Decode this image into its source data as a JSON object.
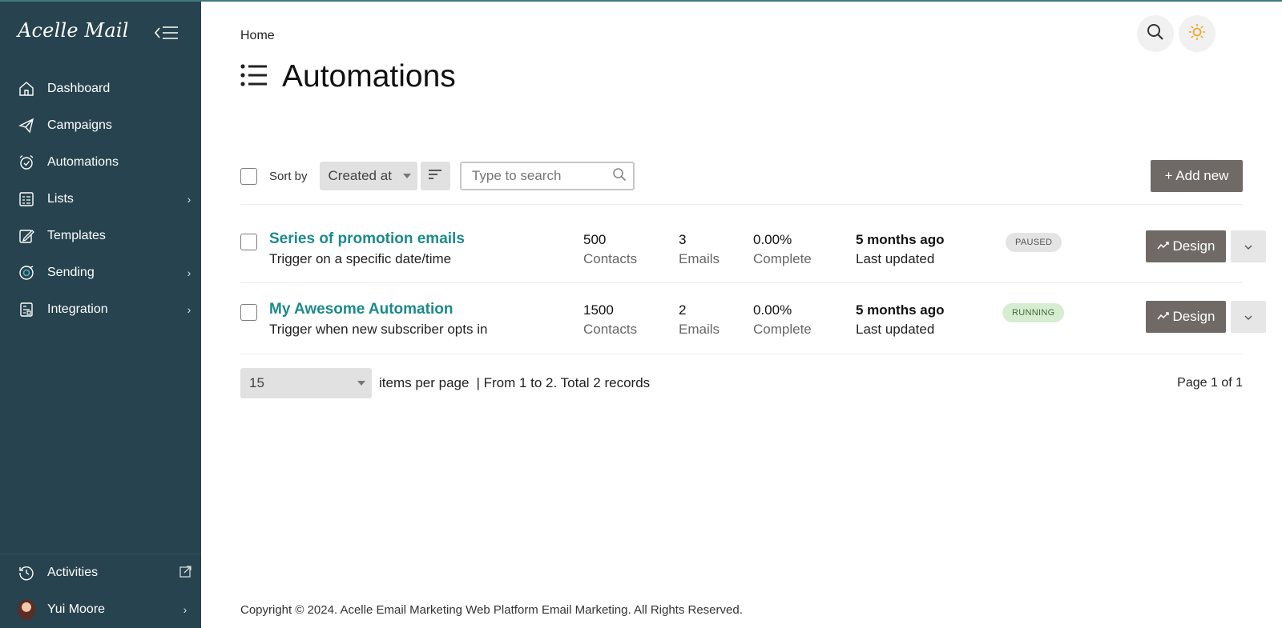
{
  "brand": {
    "logo_text": "Acelle Mail"
  },
  "sidebar": {
    "items": [
      {
        "label": "Dashboard",
        "icon": "home-icon",
        "chevron": ""
      },
      {
        "label": "Campaigns",
        "icon": "paper-plane-icon",
        "chevron": ""
      },
      {
        "label": "Automations",
        "icon": "alarm-clock-icon",
        "chevron": ""
      },
      {
        "label": "Lists",
        "icon": "list-icon",
        "chevron": "›"
      },
      {
        "label": "Templates",
        "icon": "template-icon",
        "chevron": ""
      },
      {
        "label": "Sending",
        "icon": "sending-icon",
        "chevron": "›"
      },
      {
        "label": "Integration",
        "icon": "integration-icon",
        "chevron": "›"
      }
    ],
    "bottom": {
      "activities": "Activities",
      "user_name": "Yui Moore",
      "user_chevron": "›"
    }
  },
  "header": {
    "breadcrumb": "Home",
    "title": "Automations"
  },
  "toolbar": {
    "sort_by_label": "Sort by",
    "sort_value": "Created at",
    "search_placeholder": "Type to search",
    "add_new_label": "+ Add new"
  },
  "automations": [
    {
      "name": "Series of promotion emails",
      "trigger": "Trigger on a specific date/time",
      "contacts": "500",
      "contacts_label": "Contacts",
      "emails": "3",
      "emails_label": "Emails",
      "complete": "0.00%",
      "complete_label": "Complete",
      "updated": "5 months ago",
      "updated_label": "Last updated",
      "status": "PAUSED",
      "design_label": "Design"
    },
    {
      "name": "My Awesome Automation",
      "trigger": "Trigger when new subscriber opts in",
      "contacts": "1500",
      "contacts_label": "Contacts",
      "emails": "2",
      "emails_label": "Emails",
      "complete": "0.00%",
      "complete_label": "Complete",
      "updated": "5 months ago",
      "updated_label": "Last updated",
      "status": "RUNNING",
      "design_label": "Design"
    }
  ],
  "pagination": {
    "per_page": "15",
    "per_page_label": "items per page",
    "range_text": "| From 1 to 2. Total 2 records",
    "page_info": "Page 1 of 1"
  },
  "footer": {
    "copyright": "Copyright © 2024. Acelle Email Marketing Web Platform Email Marketing. All Rights Reserved."
  },
  "colors": {
    "sidebar_bg": "#27434f",
    "accent": "#1c8a8c",
    "button_bg": "#6f6a66",
    "sun": "#f4a62a"
  }
}
